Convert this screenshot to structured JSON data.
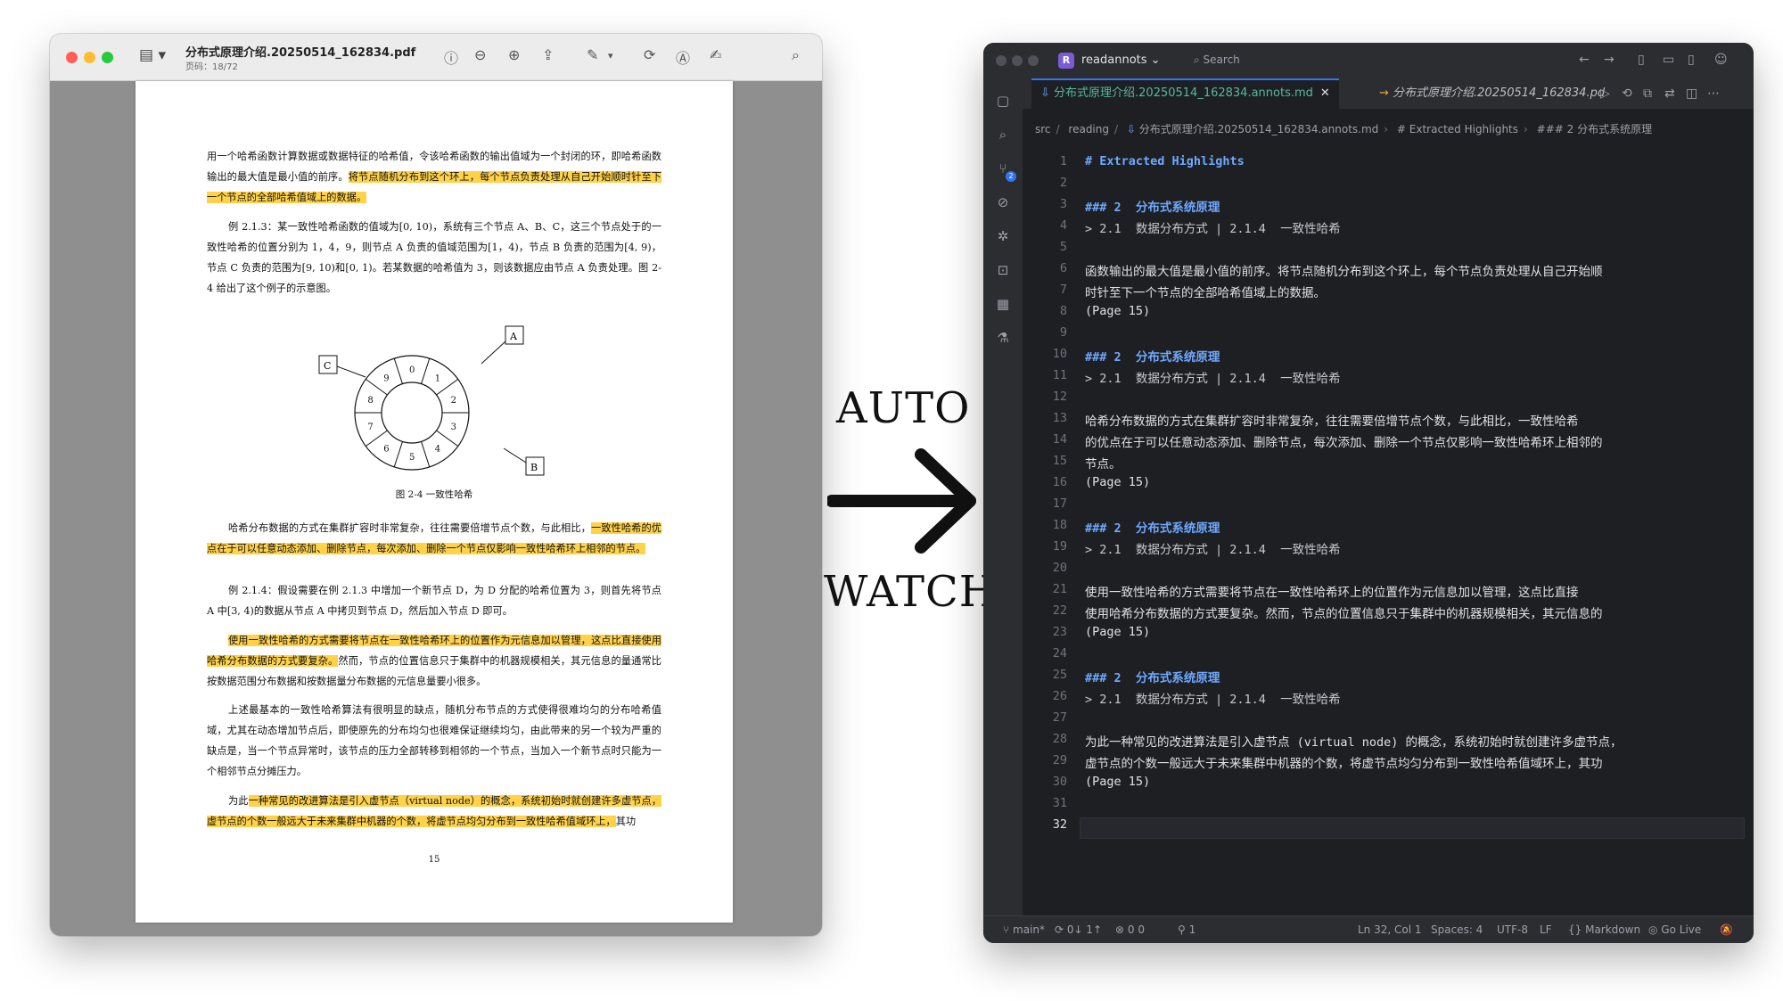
{
  "pdf_window": {
    "title": "分布式原理介绍.20250514_162834.pdf",
    "subtitle": "页码：18/72",
    "paragraphs": [
      {
        "before": "用一个哈希函数计算数据或数据特征的哈希值，令该哈希函数的输出值域为一个封闭的环，即哈希函数输出的最大值是最小值的前序。",
        "highlight": "将节点随机分布到这个环上，每个节点负责处理从自己开始顺时针至下一个节点的全部哈希值域上的数据。",
        "after": ""
      },
      {
        "before": "例 2.1.3：某一致性哈希函数的值域为[0, 10)，系统有三个节点 A、B、C，这三个节点处于的一致性哈希的位置分别为 1，4，9，则节点 A 负责的值域范围为[1，4)，节点 B 负责的范围为[4, 9)，节点 C 负责的范围为[9, 10)和[0, 1)。若某数据的哈希值为 3，则该数据应由节点 A 负责处理。图 2-4 给出了这个例子的示意图。",
        "highlight": "",
        "after": ""
      },
      {
        "before": "哈希分布数据的方式在集群扩容时非常复杂，往往需要倍增节点个数，与此相比，",
        "highlight": "一致性哈希的优点在于可以任意动态添加、删除节点，每次添加、删除一个节点仅影响一致性哈希环上相邻的节点。",
        "after": ""
      },
      {
        "before": "例 2.1.4：假设需要在例 2.1.3 中增加一个新节点 D，为 D 分配的哈希位置为 3，则首先将节点 A 中[3, 4)的数据从节点 A 中拷贝到节点 D，然后加入节点 D 即可。",
        "highlight": "",
        "after": ""
      },
      {
        "before": "",
        "highlight": "使用一致性哈希的方式需要将节点在一致性哈希环上的位置作为元信息加以管理，这点比直接使用哈希分布数据的方式要复杂。",
        "after": "然而，节点的位置信息只于集群中的机器规模相关，其元信息的量通常比按数据范围分布数据和按数据量分布数据的元信息量要小很多。"
      },
      {
        "before": "上述最基本的一致性哈希算法有很明显的缺点，随机分布节点的方式使得很难均匀的分布哈希值域，尤其在动态增加节点后，即使原先的分布均匀也很难保证继续均匀，由此带来的另一个较为严重的缺点是，当一个节点异常时，该节点的压力全部转移到相邻的一个节点，当加入一个新节点时只能为一个相邻节点分摊压力。",
        "highlight": "",
        "after": ""
      },
      {
        "before": "为此",
        "highlight": "一种常见的改进算法是引入虚节点（virtual node）的概念，系统初始时就创建许多虚节点，虚节点的个数一般远大于未来集群中机器的个数，将虚节点均匀分布到一致性哈希值域环上，",
        "after": "其功"
      }
    ],
    "figure": {
      "caption": "图 2-4 一致性哈希",
      "ring_numbers": [
        "0",
        "1",
        "2",
        "3",
        "4",
        "5",
        "6",
        "7",
        "8",
        "9"
      ],
      "nodes": [
        "A",
        "B",
        "C"
      ]
    },
    "page_number": "15"
  },
  "labels": {
    "top": "AUTO",
    "bottom": "WATCH"
  },
  "editor": {
    "project": "readannots",
    "project_initial": "R",
    "search_placeholder": "Search",
    "active_tab": "分布式原理介绍.20250514_162834.annots.md",
    "inactive_tab": "分布式原理介绍.20250514_162834.pd",
    "breadcrumbs": [
      "src",
      "reading",
      "分布式原理介绍.20250514_162834.annots.md",
      "# Extracted Highlights",
      "### 2  分布式系统原理"
    ],
    "vcs_badge": "2",
    "lines": [
      {
        "n": "1",
        "t": "# Extracted Highlights",
        "k": "h1"
      },
      {
        "n": "2",
        "t": "",
        "k": ""
      },
      {
        "n": "3",
        "t": "### 2  分布式系统原理",
        "k": "h3"
      },
      {
        "n": "4",
        "t": "> 2.1  数据分布方式 | 2.1.4  一致性哈希",
        "k": "q"
      },
      {
        "n": "5",
        "t": "",
        "k": ""
      },
      {
        "n": "6",
        "t": "函数输出的最大值是最小值的前序。将节点随机分布到这个环上，每个节点负责处理从自己开始顺",
        "k": ""
      },
      {
        "n": "7",
        "t": "时针至下一个节点的全部哈希值域上的数据。",
        "k": ""
      },
      {
        "n": "8",
        "t": "(Page 15)",
        "k": ""
      },
      {
        "n": "9",
        "t": "",
        "k": ""
      },
      {
        "n": "10",
        "t": "### 2  分布式系统原理",
        "k": "h3"
      },
      {
        "n": "11",
        "t": "> 2.1  数据分布方式 | 2.1.4  一致性哈希",
        "k": "q"
      },
      {
        "n": "12",
        "t": "",
        "k": ""
      },
      {
        "n": "13",
        "t": "哈希分布数据的方式在集群扩容时非常复杂，往往需要倍增节点个数，与此相比，一致性哈希",
        "k": ""
      },
      {
        "n": "14",
        "t": "的优点在于可以任意动态添加、删除节点，每次添加、删除一个节点仅影响一致性哈希环上相邻的",
        "k": ""
      },
      {
        "n": "15",
        "t": "节点。",
        "k": ""
      },
      {
        "n": "16",
        "t": "(Page 15)",
        "k": ""
      },
      {
        "n": "17",
        "t": "",
        "k": ""
      },
      {
        "n": "18",
        "t": "### 2  分布式系统原理",
        "k": "h3"
      },
      {
        "n": "19",
        "t": "> 2.1  数据分布方式 | 2.1.4  一致性哈希",
        "k": "q"
      },
      {
        "n": "20",
        "t": "",
        "k": ""
      },
      {
        "n": "21",
        "t": "使用一致性哈希的方式需要将节点在一致性哈希环上的位置作为元信息加以管理，这点比直接",
        "k": ""
      },
      {
        "n": "22",
        "t": "使用哈希分布数据的方式要复杂。然而，节点的位置信息只于集群中的机器规模相关，其元信息的",
        "k": ""
      },
      {
        "n": "23",
        "t": "(Page 15)",
        "k": ""
      },
      {
        "n": "24",
        "t": "",
        "k": ""
      },
      {
        "n": "25",
        "t": "### 2  分布式系统原理",
        "k": "h3"
      },
      {
        "n": "26",
        "t": "> 2.1  数据分布方式 | 2.1.4  一致性哈希",
        "k": "q"
      },
      {
        "n": "27",
        "t": "",
        "k": ""
      },
      {
        "n": "28",
        "t": "为此一种常见的改进算法是引入虚节点 (virtual node) 的概念，系统初始时就创建许多虚节点，",
        "k": ""
      },
      {
        "n": "29",
        "t": "虚节点的个数一般远大于未来集群中机器的个数，将虚节点均匀分布到一致性哈希值域环上，其功",
        "k": ""
      },
      {
        "n": "30",
        "t": "(Page 15)",
        "k": ""
      },
      {
        "n": "31",
        "t": "",
        "k": ""
      },
      {
        "n": "32",
        "t": "",
        "k": "cur"
      }
    ],
    "status": {
      "branch": "main*",
      "sync": "0↓ 1↑",
      "problems": "0  0",
      "ports": "1",
      "cursor": "Ln 32, Col 1",
      "spaces": "Spaces: 4",
      "encoding": "UTF-8",
      "eol": "LF",
      "language": "Markdown",
      "live": "Go Live"
    }
  }
}
